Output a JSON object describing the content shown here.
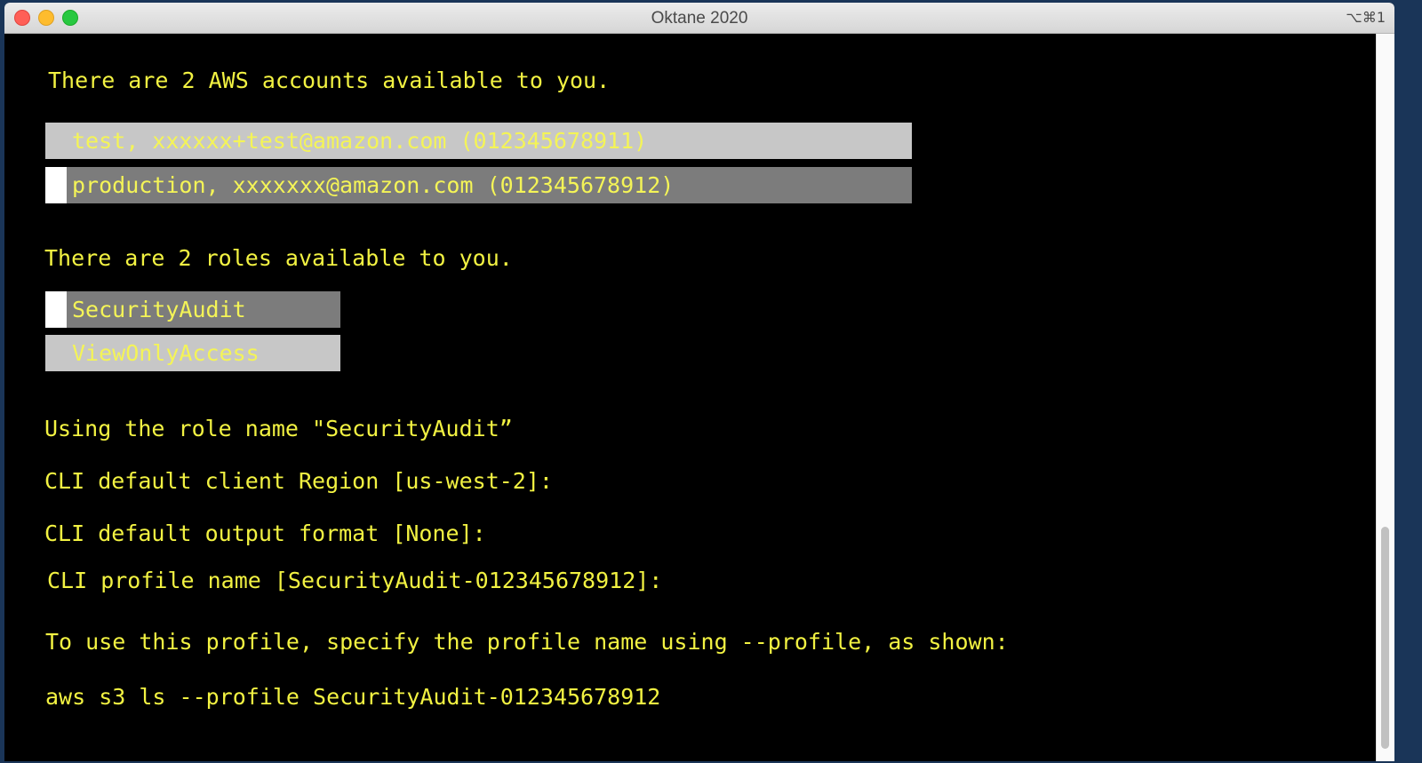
{
  "window": {
    "title": "Oktane 2020",
    "shortcut": "⌥⌘1"
  },
  "terminal": {
    "accounts_heading": "There are 2 AWS accounts available to you.",
    "accounts": [
      {
        "label": "test, xxxxxx+test@amazon.com (012345678911)",
        "selected": false
      },
      {
        "label": "production, xxxxxxx@amazon.com (012345678912)",
        "selected": true
      }
    ],
    "roles_heading": "There are 2 roles available to you.",
    "roles": [
      {
        "label": "SecurityAudit",
        "selected": true
      },
      {
        "label": "ViewOnlyAccess",
        "selected": false
      }
    ],
    "using_role": "Using the role name \"SecurityAudit”",
    "region_prompt": "CLI default client Region [us-west-2]:",
    "output_prompt": "CLI default output format [None]:",
    "profile_prompt": "CLI profile name [SecurityAudit-012345678912]:",
    "usage_hint": "To use this profile, specify the profile name using --profile, as shown:",
    "example_command": "aws s3 ls --profile SecurityAudit-012345678912"
  },
  "colors": {
    "text": "#f2f242",
    "background": "#000000",
    "highlight_unselected": "#c7c7c7",
    "highlight_selected": "#7c7c7c"
  }
}
